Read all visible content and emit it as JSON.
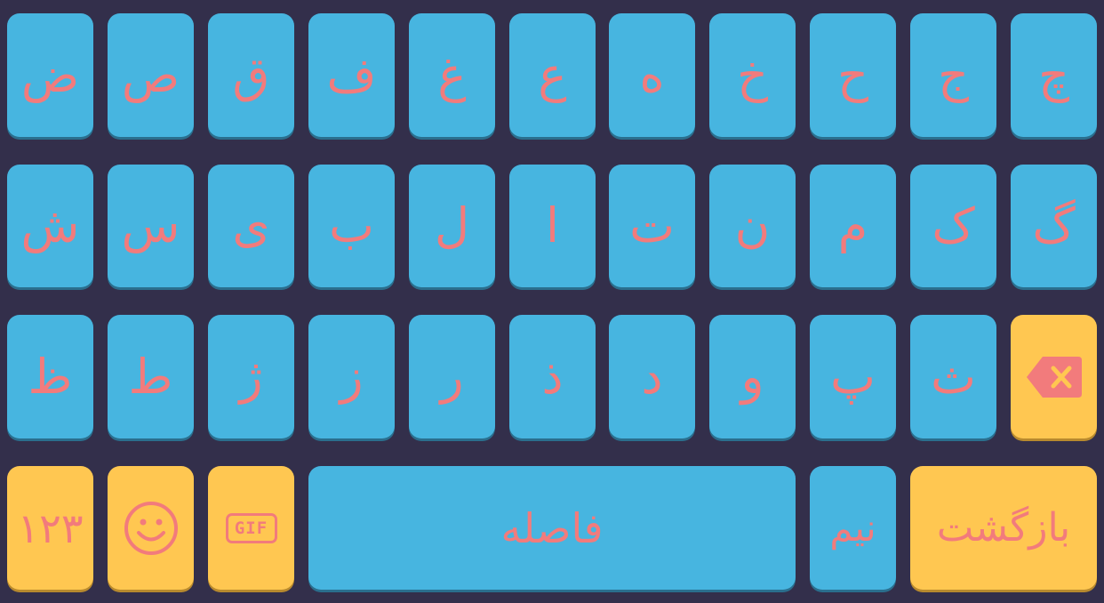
{
  "keyboard": {
    "row1": [
      "ض",
      "ص",
      "ق",
      "ف",
      "غ",
      "ع",
      "ه",
      "خ",
      "ح",
      "ج",
      "چ"
    ],
    "row2": [
      "ش",
      "س",
      "ی",
      "ب",
      "ل",
      "ا",
      "ت",
      "ن",
      "م",
      "ک",
      "گ"
    ],
    "row3": [
      "ظ",
      "ط",
      "ژ",
      "ز",
      "ر",
      "ذ",
      "د",
      "و",
      "پ",
      "ث"
    ],
    "numbers_label": "۱۲۳",
    "gif_label": "GIF",
    "space_label": "فاصله",
    "half_space_label": "نیم",
    "return_label": "بازگشت",
    "icons": {
      "backspace": "backspace-icon",
      "emoji": "smiley-icon",
      "gif": "gif-icon"
    },
    "colors": {
      "background": "#332f4b",
      "letter_key": "#47b5e0",
      "function_key": "#ffc751",
      "key_text": "#f27b7c"
    }
  }
}
